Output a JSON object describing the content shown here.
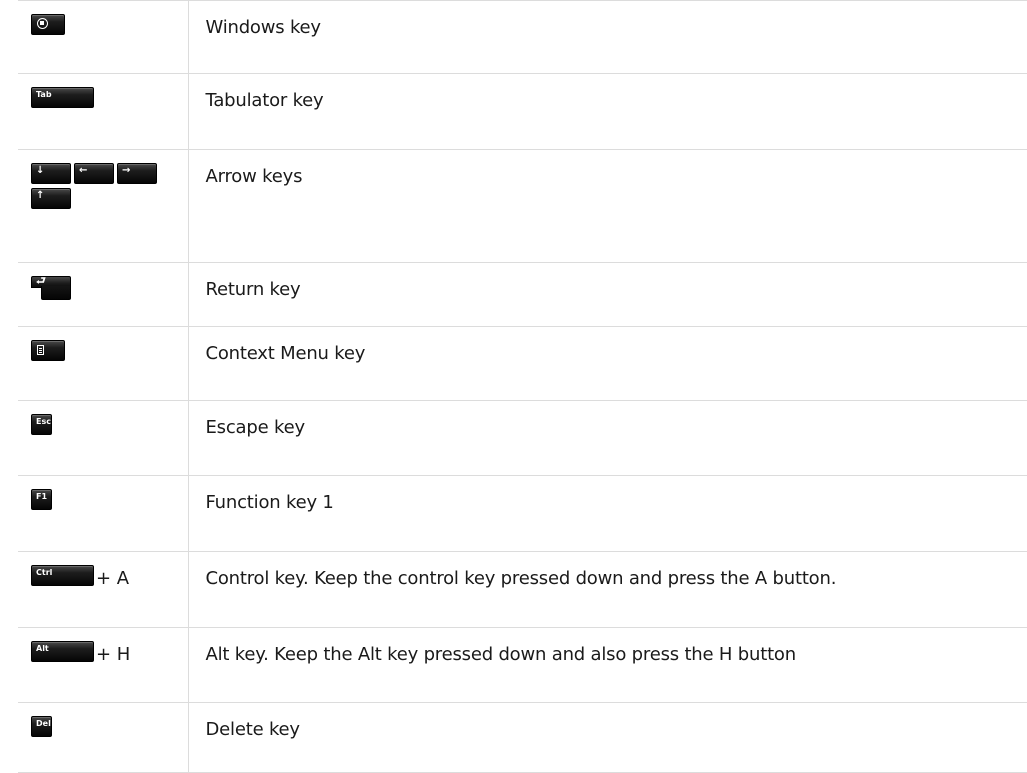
{
  "rows": [
    {
      "key_icon": "windows-logo-icon",
      "description": "Windows key"
    },
    {
      "key_label": "Tab",
      "description": "Tabulator key"
    },
    {
      "arrows": [
        "↓",
        "←",
        "→",
        "↑"
      ],
      "description": "Arrow keys"
    },
    {
      "key_glyph": "⮐",
      "description": "Return key"
    },
    {
      "key_icon": "context-menu-icon",
      "description": "Context Menu key"
    },
    {
      "key_label": "Esc",
      "description": "Escape key"
    },
    {
      "key_label": "F1",
      "description": "Function key 1"
    },
    {
      "key_label": "Ctrl",
      "suffix": "+ A",
      "description": "Control key. Keep the control key pressed down and press the A button."
    },
    {
      "key_label": "Alt",
      "suffix": "+ H",
      "description": "Alt key. Keep the Alt key pressed down and also press the H button"
    },
    {
      "key_label": "Del",
      "description": "Delete key"
    }
  ]
}
